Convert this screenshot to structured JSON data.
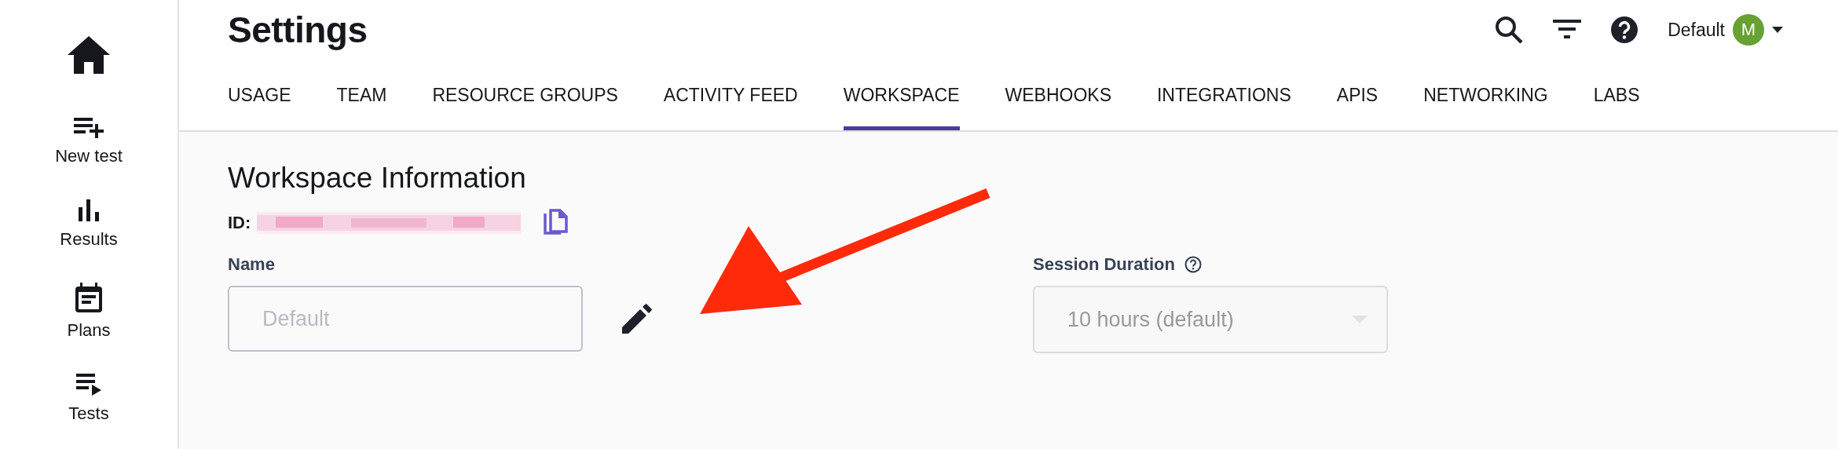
{
  "sidebar": {
    "items": [
      {
        "kind": "home"
      },
      {
        "kind": "new",
        "label": "New test"
      },
      {
        "kind": "results",
        "label": "Results"
      },
      {
        "kind": "plans",
        "label": "Plans"
      },
      {
        "kind": "tests",
        "label": "Tests"
      }
    ]
  },
  "header": {
    "title": "Settings",
    "account": "Default",
    "avatar": "M"
  },
  "tabs": [
    {
      "label": "USAGE",
      "selected": false
    },
    {
      "label": "TEAM",
      "selected": false
    },
    {
      "label": "RESOURCE GROUPS",
      "selected": false
    },
    {
      "label": "ACTIVITY FEED",
      "selected": false
    },
    {
      "label": "WORKSPACE",
      "selected": true
    },
    {
      "label": "WEBHOOKS",
      "selected": false
    },
    {
      "label": "INTEGRATIONS",
      "selected": false
    },
    {
      "label": "APIS",
      "selected": false
    },
    {
      "label": "NETWORKING",
      "selected": false
    },
    {
      "label": "LABS",
      "selected": false
    }
  ],
  "section": {
    "title": "Workspace Information",
    "id_label": "ID:",
    "name": {
      "label": "Name",
      "placeholder": "Default"
    },
    "session": {
      "label": "Session Duration",
      "value": "10 hours (default)",
      "disabled": true
    }
  }
}
